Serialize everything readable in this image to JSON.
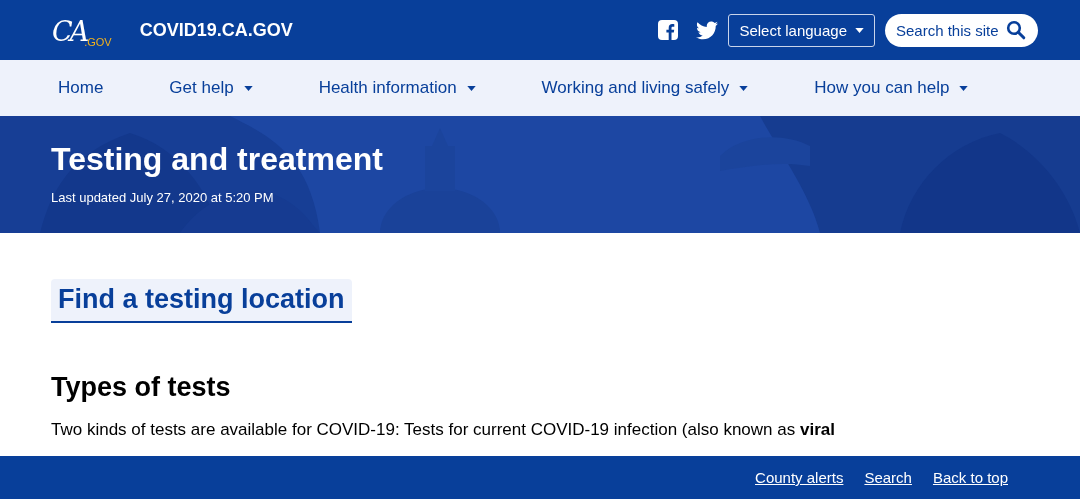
{
  "header": {
    "logo": {
      "script": "CA",
      "suffix": ".GOV"
    },
    "site_name": "COVID19.CA.GOV",
    "language_button": "Select language",
    "search": {
      "placeholder": "Search this site"
    }
  },
  "nav": [
    {
      "label": "Home",
      "has_menu": false
    },
    {
      "label": "Get help",
      "has_menu": true
    },
    {
      "label": "Health information",
      "has_menu": true
    },
    {
      "label": "Working and living safely",
      "has_menu": true
    },
    {
      "label": "How you can help",
      "has_menu": true
    }
  ],
  "hero": {
    "kind": "picture",
    "title": "Testing and treatment",
    "updated": "Last updated July 27, 2020 at 5:20 PM"
  },
  "content": {
    "cta_button": "Find a testing location",
    "heading": "Types of tests",
    "paragraph": "Two kinds of tests are available for COVID-19: Tests for current COVID-19 infection (also known as **viral**"
  },
  "footer_links": [
    "County alerts",
    "Search",
    "Back to top"
  ]
}
